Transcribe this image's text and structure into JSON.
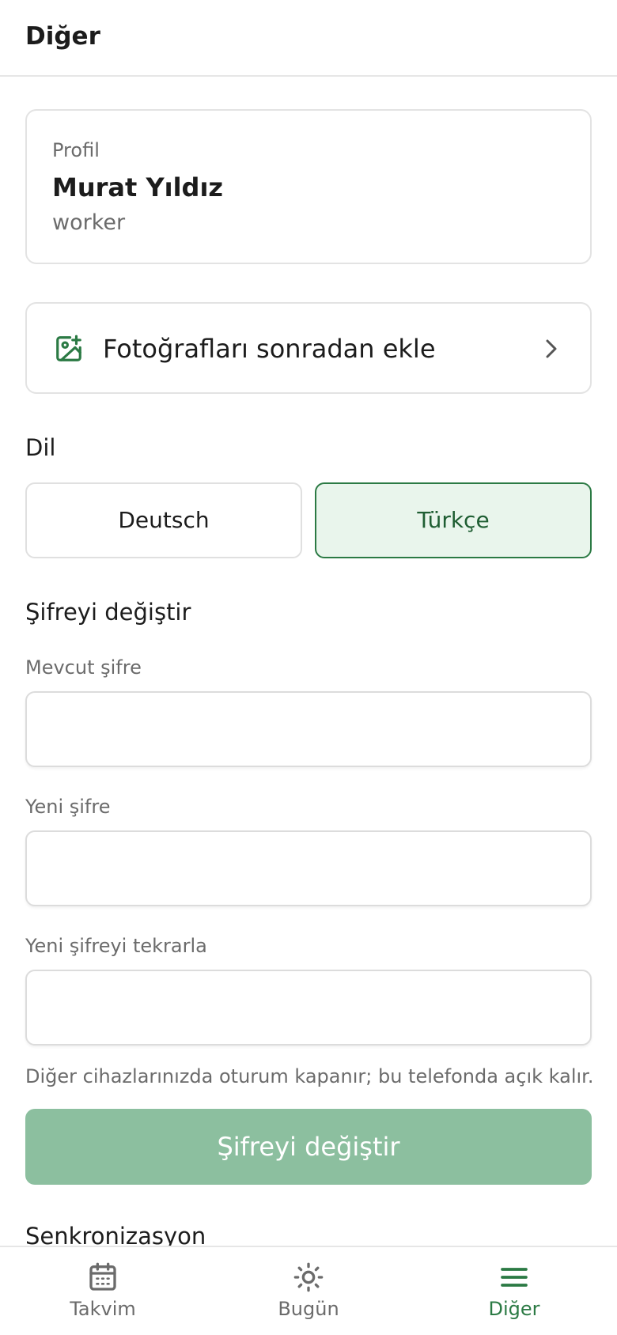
{
  "header": {
    "title": "Diğer"
  },
  "profile": {
    "label": "Profil",
    "name": "Murat Yıldız",
    "role": "worker"
  },
  "photos": {
    "label": "Fotoğrafları sonradan ekle",
    "icon": "image-add-icon"
  },
  "language": {
    "title": "Dil",
    "options": [
      {
        "label": "Deutsch",
        "selected": false
      },
      {
        "label": "Türkçe",
        "selected": true
      }
    ]
  },
  "password": {
    "title": "Şifreyi değiştir",
    "current_label": "Mevcut şifre",
    "new_label": "Yeni şifre",
    "repeat_label": "Yeni şifreyi tekrarla",
    "hint": "Diğer cihazlarınızda oturum kapanır; bu telefonda açık kalır.",
    "submit_label": "Şifreyi değiştir"
  },
  "sync": {
    "title": "Senkronizasyon"
  },
  "nav": {
    "items": [
      {
        "label": "Takvim",
        "icon": "calendar-icon",
        "active": false
      },
      {
        "label": "Bugün",
        "icon": "sun-icon",
        "active": false
      },
      {
        "label": "Diğer",
        "icon": "menu-icon",
        "active": true
      }
    ]
  },
  "colors": {
    "accent": "#2b7a44",
    "accent_light": "#e9f5ec",
    "button_disabled": "#8cbf9f",
    "muted_text": "#6b6b6b"
  }
}
